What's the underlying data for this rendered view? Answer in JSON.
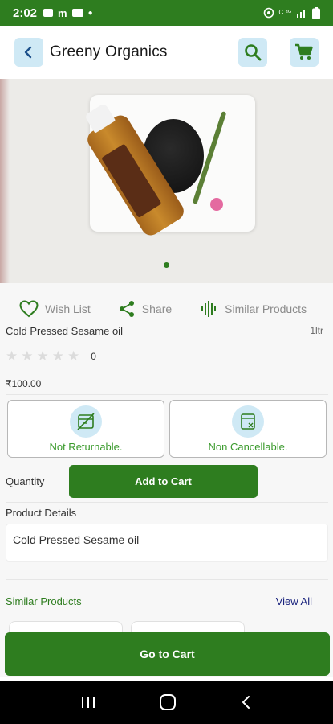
{
  "status_bar": {
    "time": "2:02",
    "left_icons": [
      "image-icon",
      "m-icon",
      "youtube-icon"
    ],
    "right_icons": [
      "hotspot-icon",
      "data-icon",
      "signal-icon",
      "battery-icon"
    ]
  },
  "header": {
    "title": "Greeny Organics",
    "back_icon": "back-arrow-icon",
    "search_icon": "search-icon",
    "cart_icon": "cart-icon"
  },
  "carousel": {
    "dots": 1,
    "active_dot": 1
  },
  "actions": {
    "wishlist": "Wish List",
    "share": "Share",
    "similar": "Similar Products"
  },
  "product": {
    "name": "Cold Pressed Sesame oil",
    "size": "1ltr",
    "rating_stars": 5,
    "rating_filled": 0,
    "rating_count": "0",
    "price": "₹100.00"
  },
  "policies": [
    {
      "label": "Not Returnable.",
      "icon": "no-return-icon"
    },
    {
      "label": "Non Cancellable.",
      "icon": "no-cancel-icon"
    }
  ],
  "quantity": {
    "label": "Quantity",
    "add_button": "Add to Cart"
  },
  "details": {
    "title": "Product Details",
    "text": "Cold Pressed Sesame oil"
  },
  "similar": {
    "title": "Similar Products",
    "view_all": "View All"
  },
  "go_to_cart": "Go to Cart",
  "colors": {
    "primary": "#2e7d1f",
    "icon_bg": "#cfe9f5",
    "policy_text": "#3a9a2c",
    "link": "#1a237e"
  }
}
